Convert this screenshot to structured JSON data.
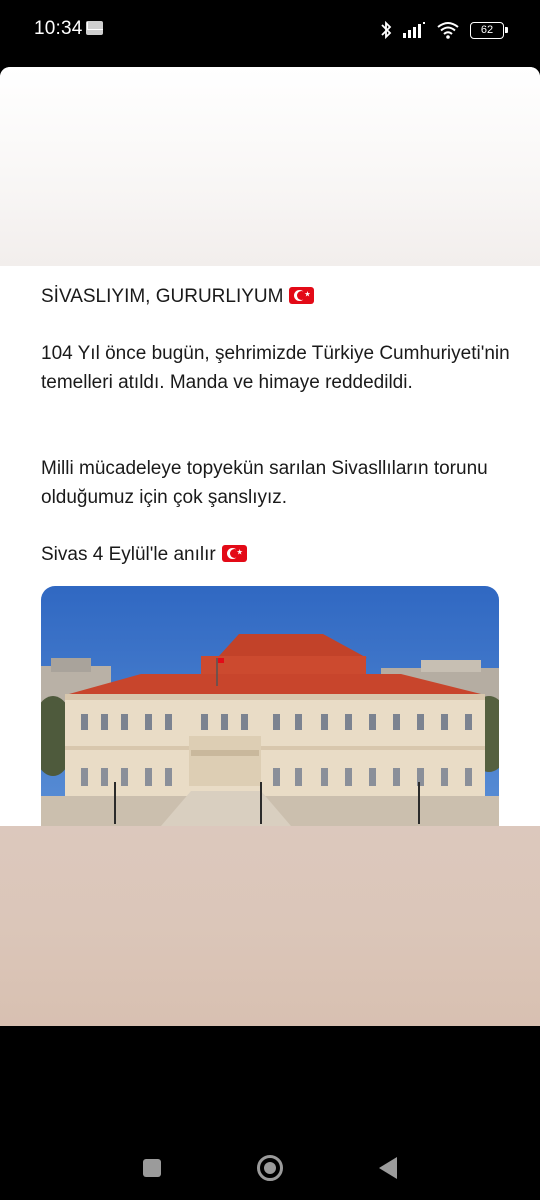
{
  "status_bar": {
    "time": "10:34",
    "battery_level": "62",
    "icons": [
      "mail-icon",
      "bluetooth-icon",
      "signal-icon",
      "wifi-icon",
      "battery-icon"
    ]
  },
  "post": {
    "title": "SİVASLIYIM, GURURLIYUM",
    "paragraph1": "104 Yıl önce bugün, şehrimizde Türkiye Cumhuriyeti'nin temelleri atıldı. Manda ve himaye reddedildi.",
    "paragraph2": "Milli mücadeleye topyekün sarılan Sivasllıların torunu olduğumuz için çok şanslıyız.",
    "tagline": "Sivas 4 Eylül'le anılır",
    "flag_icon": "turkey-flag-icon"
  },
  "nav_bar": {
    "buttons": [
      "recents-button",
      "home-button",
      "back-button"
    ]
  },
  "colors": {
    "flag_red": "#e30a17",
    "roof": "#c8452c",
    "facade": "#e9dcc6",
    "sky": "#3a73c5",
    "bottom_fade": "#dbc6b9"
  }
}
